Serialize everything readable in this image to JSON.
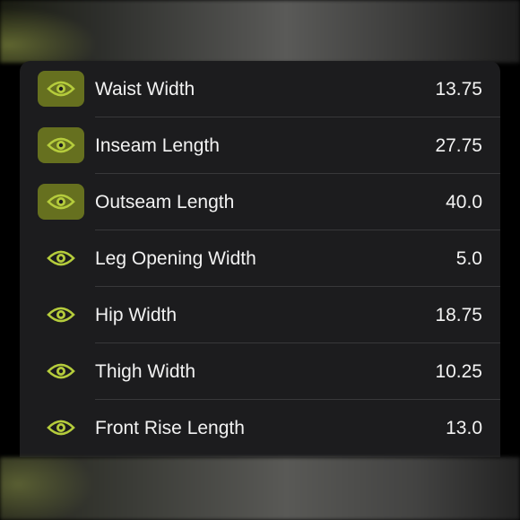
{
  "colors": {
    "accent": "#b5cc3c",
    "active_bg": "#66701f",
    "panel_bg": "#1c1c1e",
    "text": "#f2f2f2"
  },
  "measurements": [
    {
      "label": "Waist Width",
      "value": "13.75",
      "icon": "eye-icon",
      "highlighted": true
    },
    {
      "label": "Inseam Length",
      "value": "27.75",
      "icon": "eye-icon",
      "highlighted": true
    },
    {
      "label": "Outseam Length",
      "value": "40.0",
      "icon": "eye-icon",
      "highlighted": true
    },
    {
      "label": "Leg Opening Width",
      "value": "5.0",
      "icon": "eye-icon",
      "highlighted": false
    },
    {
      "label": "Hip Width",
      "value": "18.75",
      "icon": "eye-icon",
      "highlighted": false
    },
    {
      "label": "Thigh Width",
      "value": "10.25",
      "icon": "eye-icon",
      "highlighted": false
    },
    {
      "label": "Front Rise Length",
      "value": "13.0",
      "icon": "eye-icon",
      "highlighted": false
    }
  ]
}
